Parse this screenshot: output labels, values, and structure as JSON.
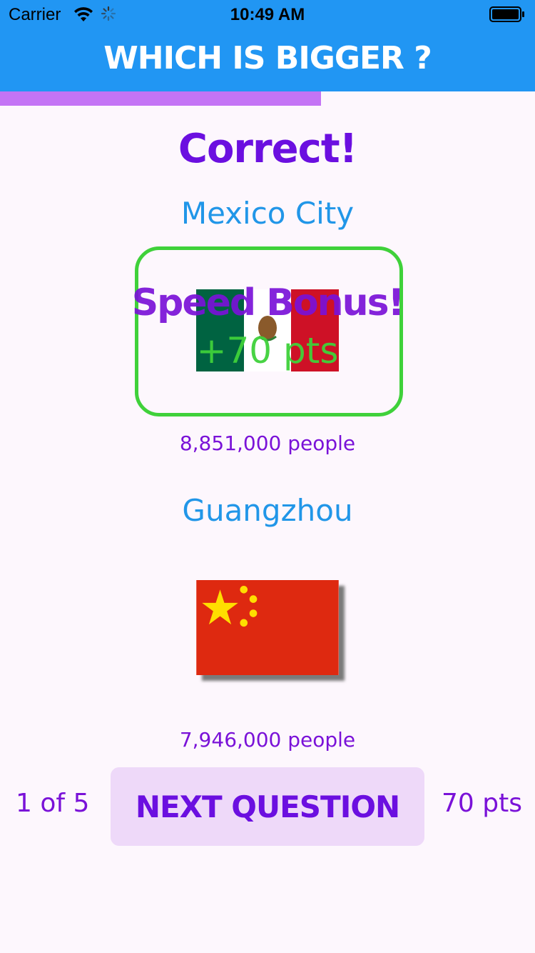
{
  "status_bar": {
    "carrier": "Carrier",
    "time": "10:49 AM"
  },
  "header": {
    "title": "WHICH IS BIGGER ?",
    "color": "#2196f3"
  },
  "progress": {
    "fraction": 0.6,
    "color": "#c474f5"
  },
  "result": {
    "title": "Correct!"
  },
  "city_a": {
    "name": "Mexico City",
    "population": "8,851,000 people",
    "flag": "mexico-flag"
  },
  "bonus": {
    "title": "Speed Bonus!",
    "points": "+70 pts"
  },
  "city_b": {
    "name": "Guangzhou",
    "population": "7,946,000 people",
    "flag": "china-flag"
  },
  "footer": {
    "question_count": "1 of 5",
    "next_label": "NEXT QUESTION",
    "score": "70 pts"
  },
  "colors": {
    "accent": "#6b0fe0",
    "highlight": "#3fd13a",
    "city": "#2196e8"
  }
}
